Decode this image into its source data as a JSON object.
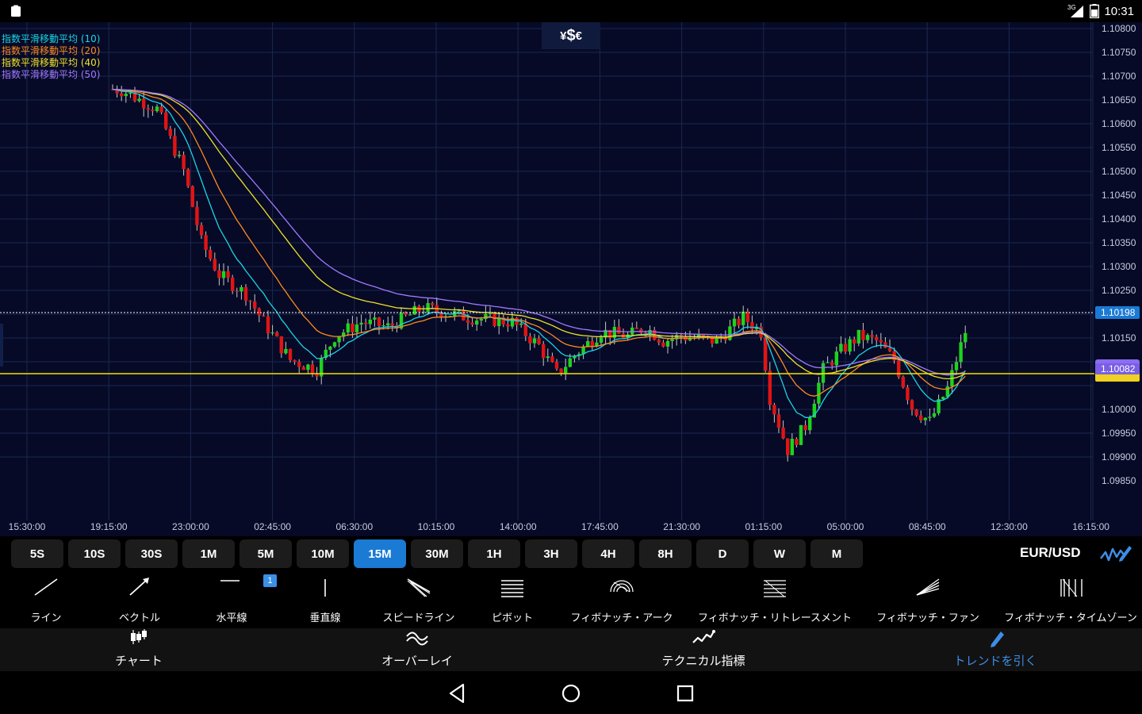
{
  "status_bar": {
    "time": "10:31",
    "network": "3G"
  },
  "chart": {
    "logo_parts": [
      "¥",
      "$",
      "€"
    ],
    "pair": "EUR/USD",
    "current_price_label": "1.10198",
    "line_price_label": "1.10082",
    "legend": [
      {
        "label": "指数平滑移動平均 (10)",
        "color": "#19d6e6"
      },
      {
        "label": "指数平滑移動平均 (20)",
        "color": "#ff8a1e"
      },
      {
        "label": "指数平滑移動平均 (40)",
        "color": "#f0e02a"
      },
      {
        "label": "指数平滑移動平均 (50)",
        "color": "#a078ff"
      }
    ],
    "y_ticks": [
      "1.10800",
      "1.10750",
      "1.10700",
      "1.10650",
      "1.10600",
      "1.10550",
      "1.10500",
      "1.10450",
      "1.10400",
      "1.10350",
      "1.10300",
      "1.10250",
      "1.10150",
      "1.10000",
      "1.09950",
      "1.09900",
      "1.09850"
    ],
    "x_ticks": [
      "15:30:00",
      "19:15:00",
      "23:00:00",
      "02:45:00",
      "06:30:00",
      "10:15:00",
      "14:00:00",
      "17:45:00",
      "21:30:00",
      "01:15:00",
      "05:00:00",
      "08:45:00",
      "12:30:00",
      "16:15:00"
    ],
    "colors": {
      "background": "#060a26",
      "up": "#1ed31e",
      "down": "#e11414",
      "horizontal_line": "#f0e000",
      "accent": "#1a7ad4"
    }
  },
  "timeframes": [
    {
      "label": "5S",
      "active": false
    },
    {
      "label": "10S",
      "active": false
    },
    {
      "label": "30S",
      "active": false
    },
    {
      "label": "1M",
      "active": false
    },
    {
      "label": "5M",
      "active": false
    },
    {
      "label": "10M",
      "active": false
    },
    {
      "label": "15M",
      "active": true
    },
    {
      "label": "30M",
      "active": false
    },
    {
      "label": "1H",
      "active": false
    },
    {
      "label": "3H",
      "active": false
    },
    {
      "label": "4H",
      "active": false
    },
    {
      "label": "8H",
      "active": false
    },
    {
      "label": "D",
      "active": false
    },
    {
      "label": "W",
      "active": false
    },
    {
      "label": "M",
      "active": false
    }
  ],
  "tools": [
    {
      "label": "ライン",
      "icon": "line-icon"
    },
    {
      "label": "ベクトル",
      "icon": "vector-icon"
    },
    {
      "label": "水平線",
      "icon": "horizontal-line-icon",
      "badge": "1"
    },
    {
      "label": "垂直線",
      "icon": "vertical-line-icon"
    },
    {
      "label": "スピードライン",
      "icon": "speed-line-icon"
    },
    {
      "label": "ピボット",
      "icon": "pivot-icon"
    },
    {
      "label": "フィボナッチ・アーク",
      "icon": "fibonacci-arc-icon"
    },
    {
      "label": "フィボナッチ・リトレースメント",
      "icon": "fibonacci-retracement-icon"
    },
    {
      "label": "フィボナッチ・ファン",
      "icon": "fibonacci-fan-icon"
    },
    {
      "label": "フィボナッチ・タイムゾーン",
      "icon": "fibonacci-timezone-icon"
    }
  ],
  "tabs": [
    {
      "label": "チャート",
      "icon": "candlestick-icon",
      "active": false
    },
    {
      "label": "オーバーレイ",
      "icon": "overlay-wave-icon",
      "active": false
    },
    {
      "label": "テクニカル指標",
      "icon": "indicator-icon",
      "active": false
    },
    {
      "label": "トレンドを引く",
      "icon": "pencil-icon",
      "active": true
    }
  ]
}
